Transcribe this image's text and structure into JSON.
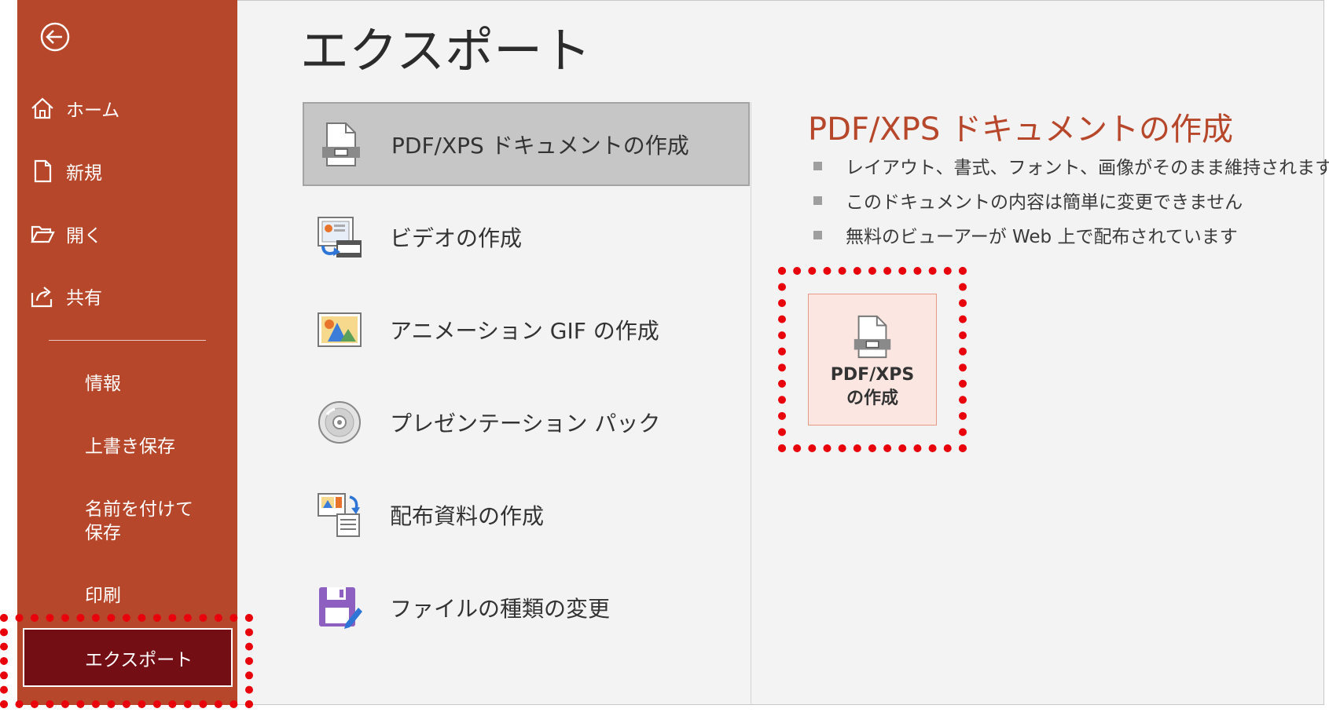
{
  "sidebar": {
    "back_icon": "back-arrow-icon",
    "items": [
      {
        "label": "ホーム",
        "icon": "home-icon"
      },
      {
        "label": "新規",
        "icon": "new-document-icon"
      },
      {
        "label": "開く",
        "icon": "open-folder-icon"
      },
      {
        "label": "共有",
        "icon": "share-icon"
      }
    ],
    "sub_items": [
      {
        "label": "情報"
      },
      {
        "label": "上書き保存"
      },
      {
        "label": "名前を付けて保存"
      },
      {
        "label": "印刷"
      }
    ],
    "active_item": {
      "label": "エクスポート"
    },
    "colors": {
      "background": "#b7472a",
      "active": "#720e14"
    }
  },
  "main": {
    "title": "エクスポート",
    "options": [
      {
        "label": "PDF/XPS ドキュメントの作成",
        "icon": "pdf-document-icon",
        "selected": true
      },
      {
        "label": "ビデオの作成",
        "icon": "video-icon",
        "selected": false
      },
      {
        "label": "アニメーション GIF の作成",
        "icon": "gif-image-icon",
        "selected": false
      },
      {
        "label": "プレゼンテーション パック",
        "icon": "cd-icon",
        "selected": false
      },
      {
        "label": "配布資料の作成",
        "icon": "handouts-icon",
        "selected": false
      },
      {
        "label": "ファイルの種類の変更",
        "icon": "save-as-icon",
        "selected": false
      }
    ]
  },
  "detail": {
    "title": "PDF/XPS ドキュメントの作成",
    "bullets": [
      "レイアウト、書式、フォント、画像がそのまま維持されます",
      "このドキュメントの内容は簡単に変更できません",
      "無料のビューアーが Web 上で配布されています"
    ],
    "button": {
      "line1": "PDF/XPS",
      "line2": "の作成",
      "icon": "pdf-document-icon"
    },
    "colors": {
      "title": "#b7472a",
      "highlight": "#e8000b"
    }
  }
}
